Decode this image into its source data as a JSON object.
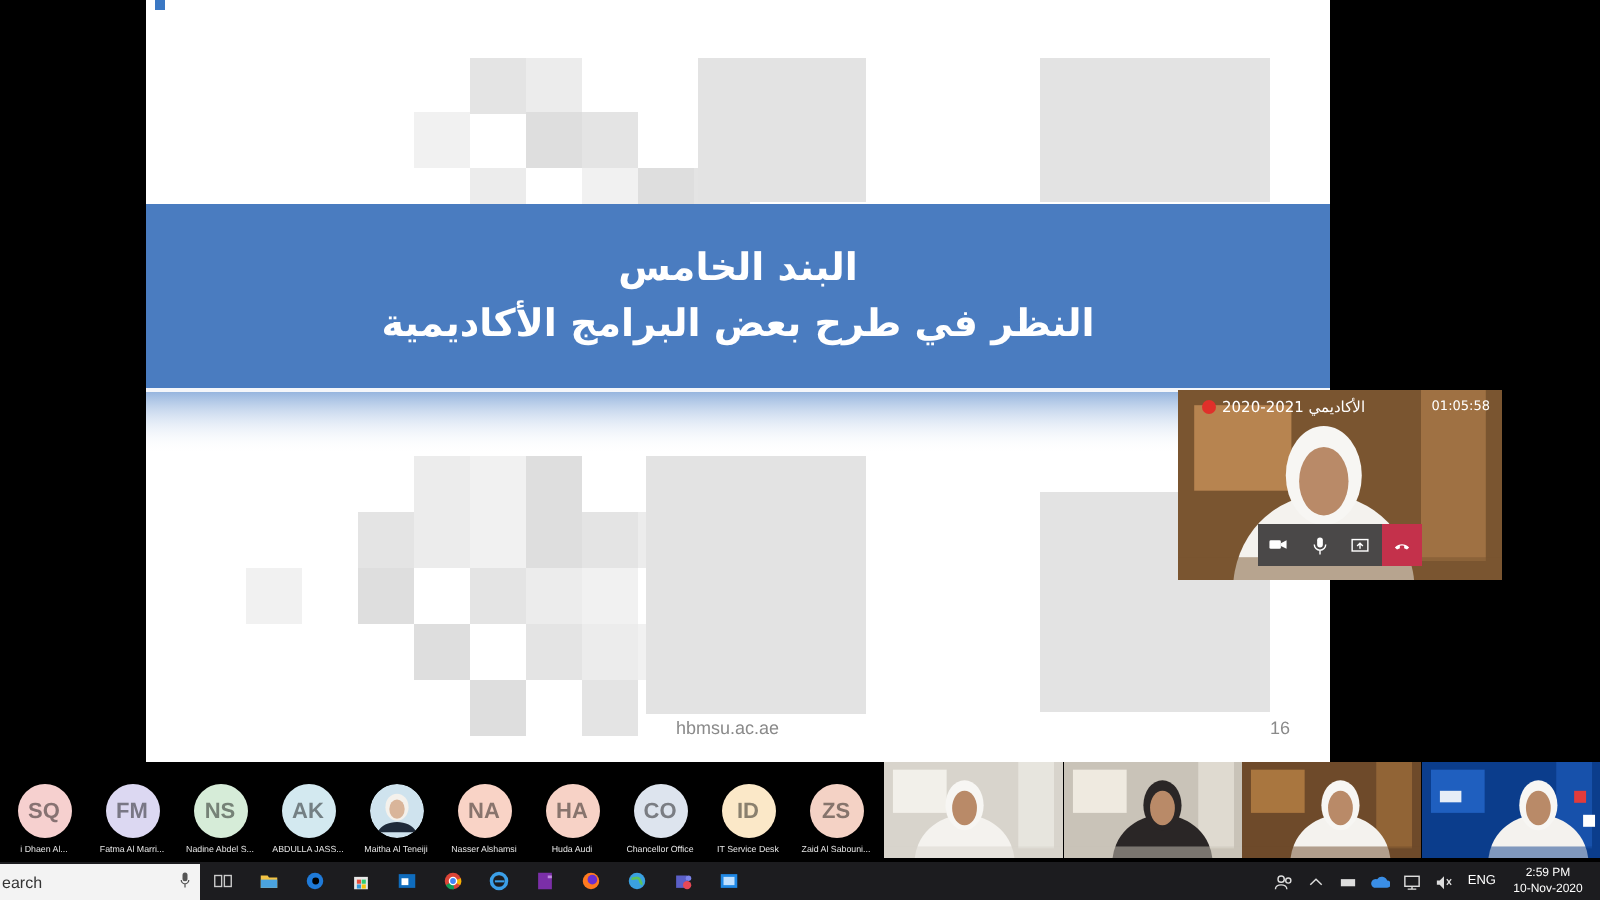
{
  "slide": {
    "title": "البند الخامس",
    "subtitle": "النظر في طرح بعض البرامج الأكاديمية",
    "site": "hbmsu.ac.ae",
    "page_number": "16"
  },
  "self_view": {
    "recording": true,
    "title": "الأكاديمي 2021-2020",
    "timer": "01:05:58",
    "kind": "picture"
  },
  "participants": [
    {
      "kind": "initials",
      "initials": "SQ",
      "name": "i Dhaen Al...",
      "color": "#f6d0cf"
    },
    {
      "kind": "initials",
      "initials": "FM",
      "name": "Fatma Al Marri...",
      "color": "#dcd8f2"
    },
    {
      "kind": "initials",
      "initials": "NS",
      "name": "Nadine Abdel S...",
      "color": "#d6ecd8"
    },
    {
      "kind": "initials",
      "initials": "AK",
      "name": "ABDULLA JASS...",
      "color": "#d3e9f0"
    },
    {
      "name": "Maitha Al Teneiji",
      "color": "#cfe3ee"
    },
    {
      "kind": "initials",
      "initials": "NA",
      "name": "Nasser Alshamsi",
      "color": "#f9d3c6"
    },
    {
      "kind": "initials",
      "initials": "HA",
      "name": "Huda Audi",
      "color": "#f7d2c6"
    },
    {
      "kind": "initials",
      "initials": "CO",
      "name": "Chancellor Office",
      "color": "#dde4ee"
    },
    {
      "kind": "initials",
      "initials": "ID",
      "name": "IT Service Desk",
      "color": "#fbe8c8"
    },
    {
      "kind": "initials",
      "initials": "ZS",
      "name": "Zaid Al Sabouni...",
      "color": "#f4d2c5"
    }
  ],
  "taskbar": {
    "search_placeholder": "earch",
    "language": "ENG",
    "time": "2:59 PM",
    "date": "10-Nov-2020"
  }
}
